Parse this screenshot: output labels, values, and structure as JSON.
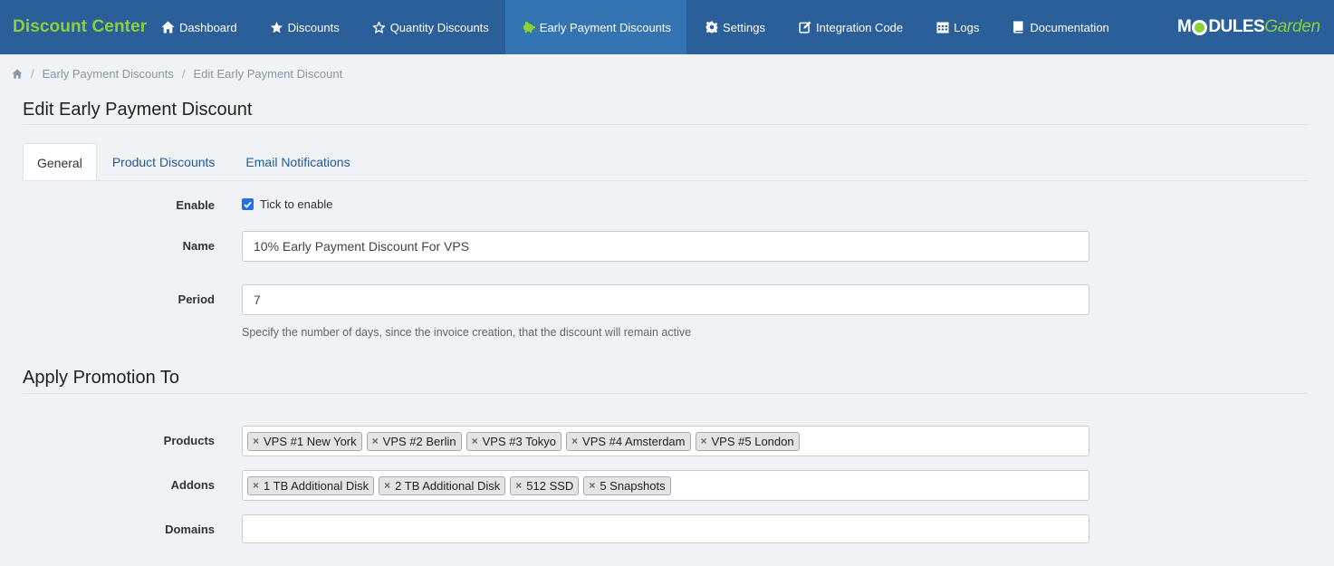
{
  "nav": {
    "brand": "Discount Center",
    "items": [
      {
        "label": "Dashboard",
        "icon": "home-icon"
      },
      {
        "label": "Discounts",
        "icon": "star-icon"
      },
      {
        "label": "Quantity Discounts",
        "icon": "star-outline-icon"
      },
      {
        "label": "Early Payment Discounts",
        "icon": "piggy-bank-icon"
      },
      {
        "label": "Settings",
        "icon": "gear-icon"
      },
      {
        "label": "Integration Code",
        "icon": "edit-icon"
      },
      {
        "label": "Logs",
        "icon": "calendar-icon"
      },
      {
        "label": "Documentation",
        "icon": "book-icon"
      }
    ],
    "active": "Early Payment Discounts",
    "logo_a": "M",
    "logo_b": "DULES",
    "logo_c": "Garden"
  },
  "breadcrumb": {
    "items": [
      "Early Payment Discounts",
      "Edit Early Payment Discount"
    ],
    "separator": "/"
  },
  "page": {
    "title": "Edit Early Payment Discount"
  },
  "tabs": [
    "General",
    "Product Discounts",
    "Email Notifications"
  ],
  "form": {
    "enable_label": "Enable",
    "enable_text": "Tick to enable",
    "enable_checked": true,
    "name_label": "Name",
    "name_value": "10% Early Payment Discount For VPS",
    "period_label": "Period",
    "period_value": "7",
    "period_help": "Specify the number of days, since the invoice creation, that the discount will remain active"
  },
  "promotion": {
    "title": "Apply Promotion To",
    "products_label": "Products",
    "products": [
      "VPS #1 New York",
      "VPS #2 Berlin",
      "VPS #3 Tokyo",
      "VPS #4 Amsterdam",
      "VPS #5 London"
    ],
    "addons_label": "Addons",
    "addons": [
      "1 TB Additional Disk",
      "2 TB Additional Disk",
      "512 SSD",
      "5 Snapshots"
    ],
    "domains_label": "Domains",
    "domains": []
  },
  "colors": {
    "navbar": "#2a5f9a",
    "nav_active": "#3574b3",
    "brand": "#8ad13a",
    "link": "#1f5a99"
  }
}
